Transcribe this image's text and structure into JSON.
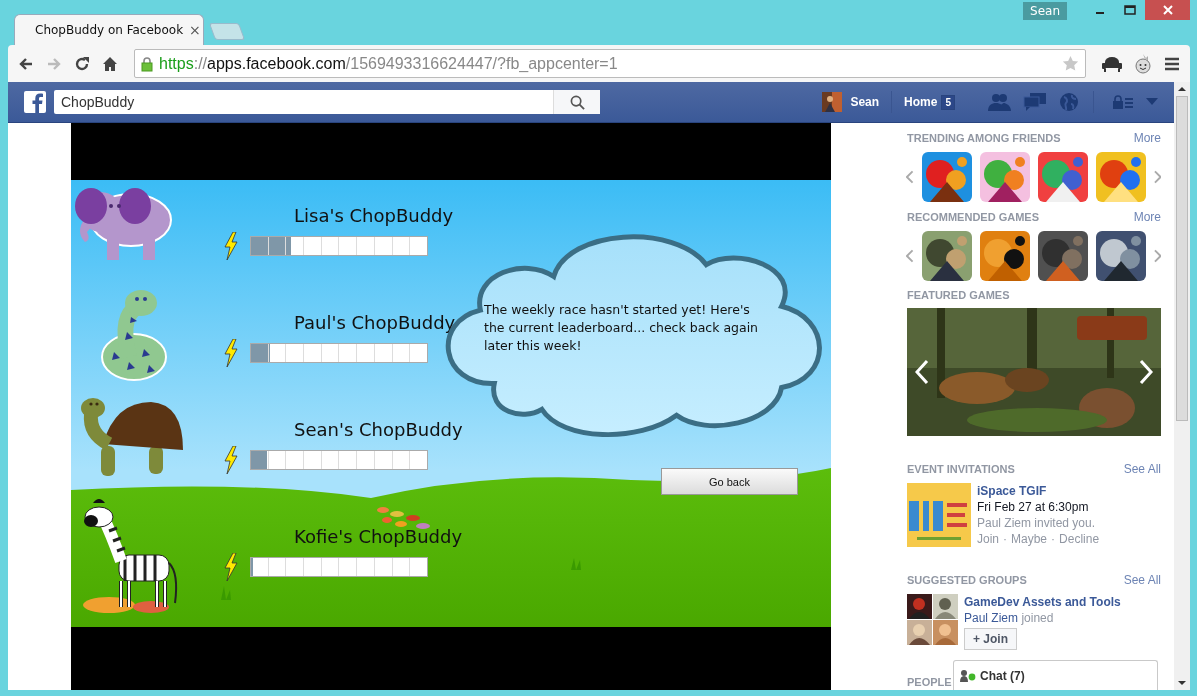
{
  "browser": {
    "profile": "Sean",
    "tabs": [
      {
        "title": "ChopBuddy on Facebook",
        "close": "×"
      }
    ],
    "url": {
      "scheme": "https",
      "separator": "://",
      "host": "apps.facebook.com",
      "path": "/1569493316624447/?fb_appcenter=1"
    }
  },
  "facebook": {
    "search": "ChopBuddy",
    "user": "Sean",
    "home": "Home",
    "home_count": "5"
  },
  "game": {
    "message": "The weekly race hasn't started yet! Here's the current leaderboard... check back again later this week!",
    "button": "Go back",
    "buddies": [
      {
        "name": "Lisa's ChopBuddy",
        "kind": "elephant",
        "level": 0.23
      },
      {
        "name": "Paul's ChopBuddy",
        "kind": "snake",
        "level": 0.11
      },
      {
        "name": "Sean's ChopBuddy",
        "kind": "turtle",
        "level": 0.09
      },
      {
        "name": "Kofie's ChopBuddy",
        "kind": "zebra",
        "level": 0.01
      }
    ]
  },
  "sidebar": {
    "sections": [
      {
        "kind": "icons",
        "title": "TRENDING AMONG FRIENDS",
        "more": "More"
      },
      {
        "kind": "icons",
        "title": "RECOMMENDED GAMES",
        "more": "More"
      },
      {
        "kind": "featured",
        "title": "FEATURED GAMES"
      },
      {
        "kind": "event",
        "title": "EVENT INVITATIONS",
        "more": "See All",
        "name": "iSpace TGIF",
        "when": "Fri Feb 27 at 6:30pm",
        "note": "Paul Ziem invited you.",
        "actions": [
          "Join",
          "Maybe",
          "Decline"
        ],
        "separator": "·"
      },
      {
        "kind": "group",
        "title": "SUGGESTED GROUPS",
        "more": "See All",
        "name": "GameDev Assets and Tools",
        "member": "Paul Ziem",
        "note": "joined",
        "button": "+ Join"
      },
      {
        "kind": "people",
        "title": "PEOPLE"
      }
    ]
  },
  "chat": {
    "label": "Chat (7)"
  }
}
